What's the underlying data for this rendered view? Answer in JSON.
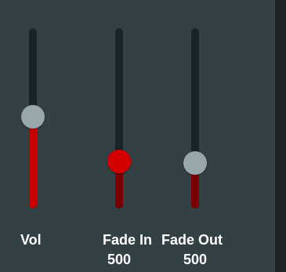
{
  "colors": {
    "background": "#334044",
    "track": "#1a2326",
    "right_strip": "#1f2326",
    "text": "#ffffff"
  },
  "sliders": [
    {
      "key": "vol",
      "label": "Vol",
      "value_text": "",
      "level": 0.51,
      "fill_color": "#c40000",
      "thumb_color": "#98a7ab",
      "thumb_icon": "circle-thumb-icon"
    },
    {
      "key": "fadein",
      "label": "Fade In",
      "value_text": "500",
      "level": 0.26,
      "fill_color": "#7a0000",
      "thumb_color": "#d40000",
      "thumb_icon": "circle-thumb-icon"
    },
    {
      "key": "fadeout",
      "label": "Fade Out",
      "value_text": "500",
      "level": 0.25,
      "fill_color": "#7a0000",
      "thumb_color": "#98a7ab",
      "thumb_icon": "circle-thumb-icon"
    }
  ]
}
